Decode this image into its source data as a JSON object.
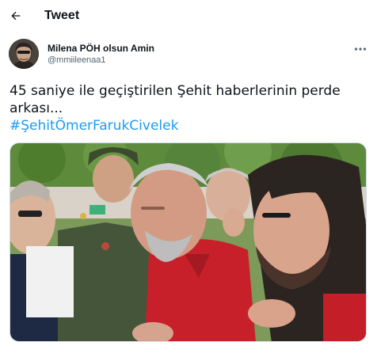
{
  "header": {
    "title": "Tweet",
    "back_icon": "arrow-left-icon"
  },
  "author": {
    "name": "Milena PÖH olsun Amin",
    "handle": "@mmiileenaa1",
    "avatar_icon": "avatar-photo"
  },
  "menu": {
    "more_icon": "more-horizontal-icon"
  },
  "tweet": {
    "line1": "45 saniye ile geçiştirilen Şehit haberlerinin perde",
    "line2": "arkası...",
    "hashtag": "#ŞehitÖmerFarukCivelek"
  },
  "media": {
    "type": "photo"
  },
  "colors": {
    "accent": "#1d9bf0",
    "text": "#0f1419",
    "secondary": "#536471"
  }
}
